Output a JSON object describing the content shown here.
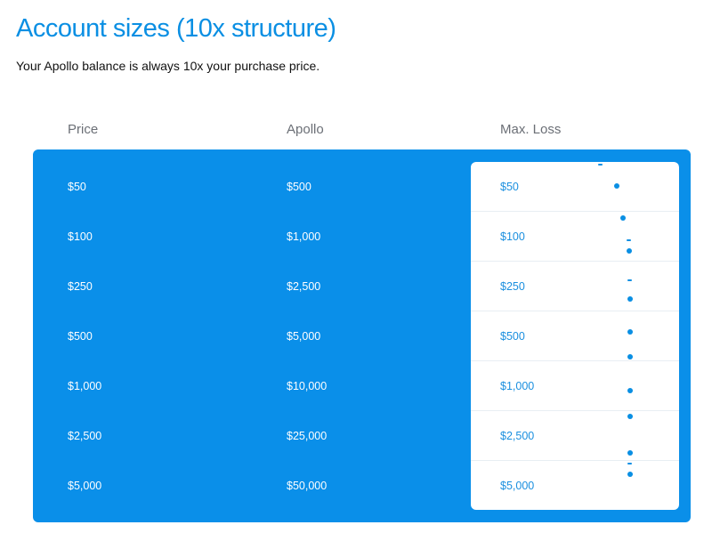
{
  "heading": {
    "title": "Account sizes (10x structure)",
    "subtitle": "Your Apollo balance is always 10x your purchase price."
  },
  "table": {
    "columns": [
      "Price",
      "Apollo",
      "Max. Loss"
    ],
    "rows": [
      {
        "price": "$50",
        "apollo": "$500",
        "max_loss": "$50"
      },
      {
        "price": "$100",
        "apollo": "$1,000",
        "max_loss": "$100"
      },
      {
        "price": "$250",
        "apollo": "$2,500",
        "max_loss": "$250"
      },
      {
        "price": "$500",
        "apollo": "$5,000",
        "max_loss": "$500"
      },
      {
        "price": "$1,000",
        "apollo": "$10,000",
        "max_loss": "$1,000"
      },
      {
        "price": "$2,500",
        "apollo": "$25,000",
        "max_loss": "$2,500"
      },
      {
        "price": "$5,000",
        "apollo": "$50,000",
        "max_loss": "$5,000"
      }
    ]
  },
  "colors": {
    "accent": "#0a8fe3",
    "panel_background": "#0a8fe9",
    "max_loss_text": "#1a8fdf",
    "header_text": "#6b6f76"
  }
}
